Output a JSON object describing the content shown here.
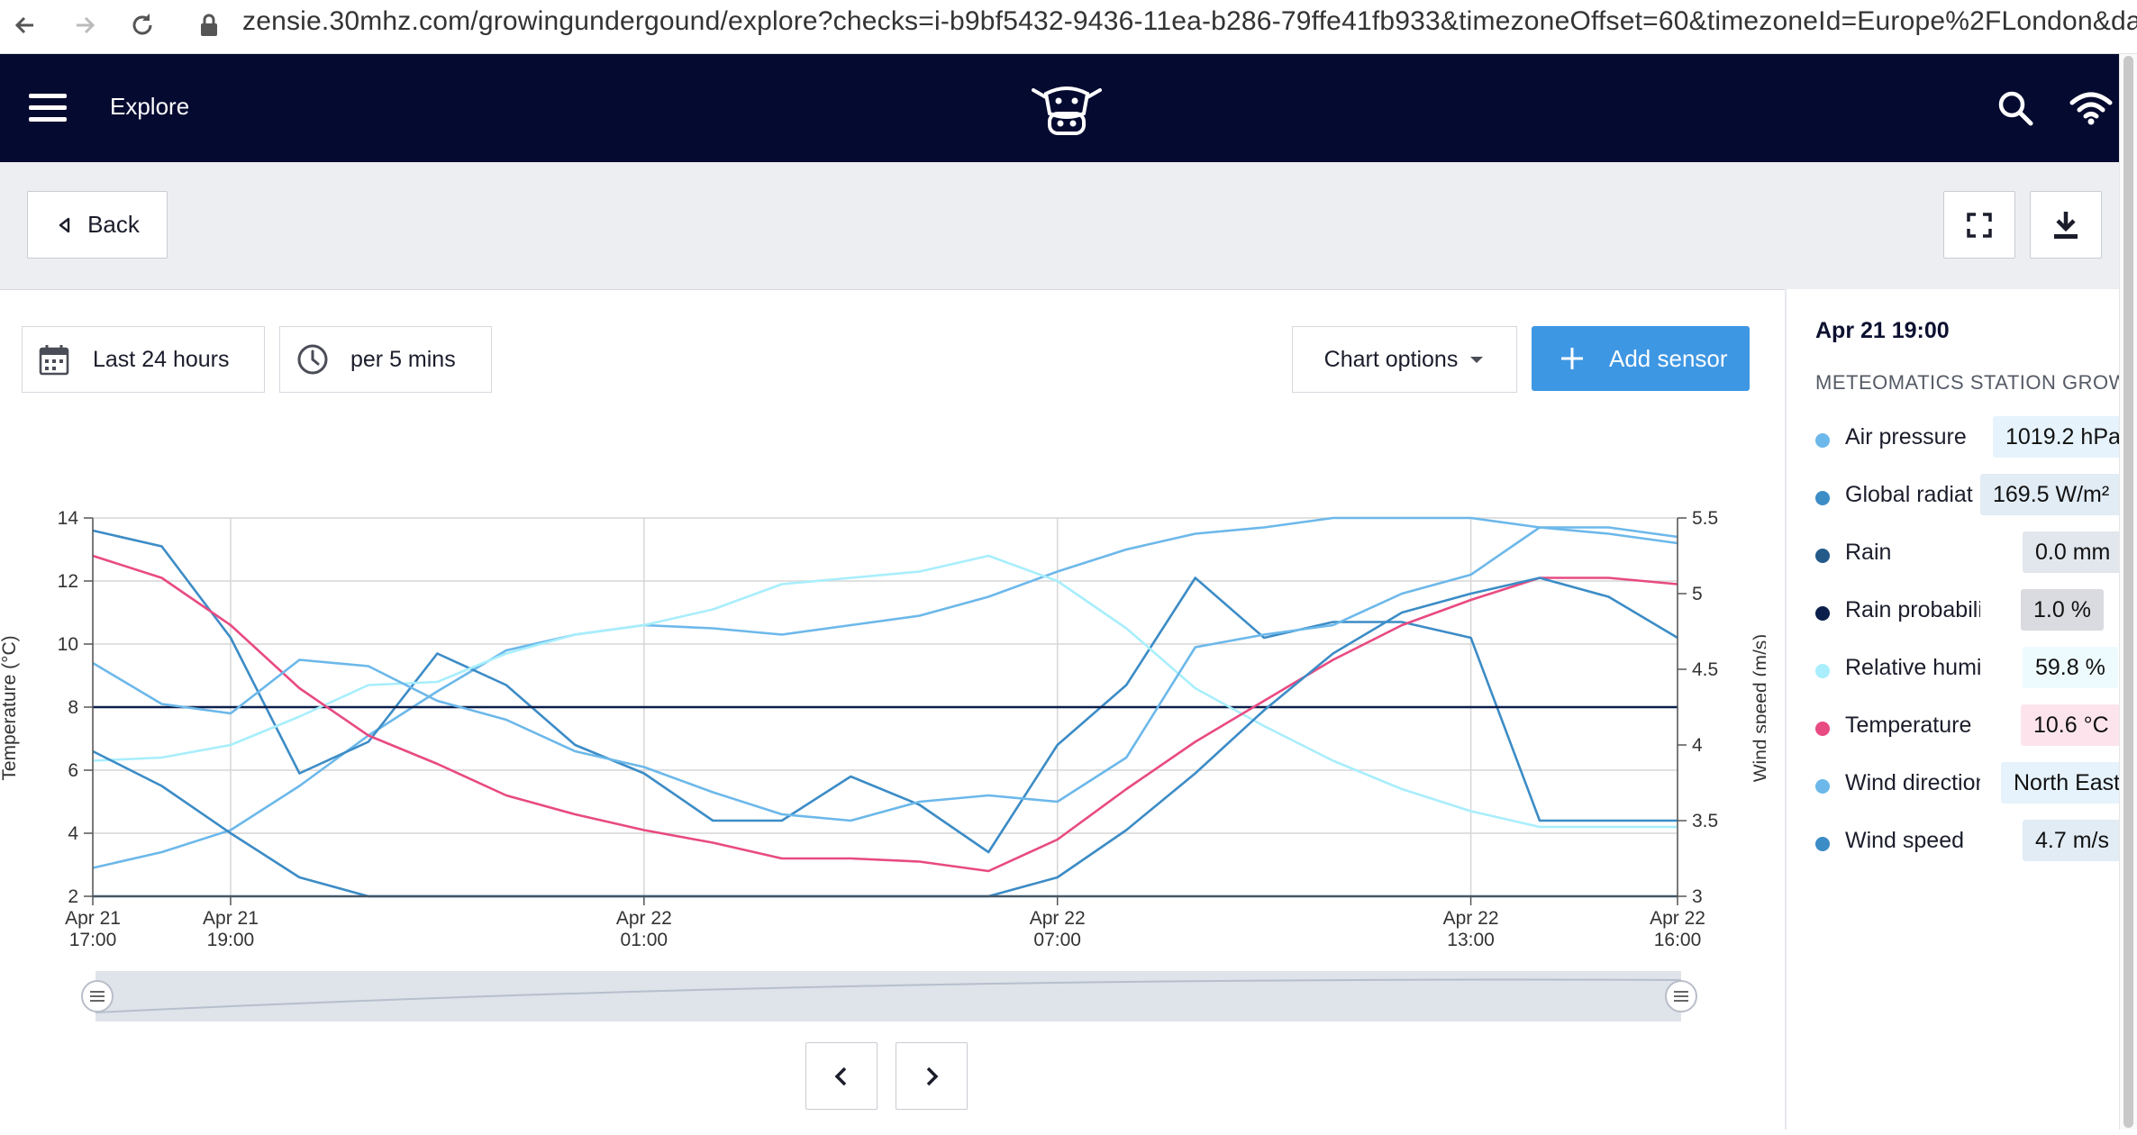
{
  "browser": {
    "url": "zensie.30mhz.com/growingundergound/explore?checks=i-b9bf5432-9436-11ea-b286-79ffe41fb933&timezoneOffset=60&timezoneId=Europe%2FLondon&da"
  },
  "header": {
    "title": "Explore"
  },
  "toolbar": {
    "back_label": "Back"
  },
  "controls": {
    "range_label": "Last 24 hours",
    "interval_label": "per 5 mins",
    "chart_options_label": "Chart options",
    "add_sensor_label": "Add sensor"
  },
  "side": {
    "timestamp": "Apr 21 19:00",
    "station": "METEOMATICS STATION GROW…",
    "items": [
      {
        "label": "Air pressure",
        "value": "1019.2 hPa",
        "color": "#6cb8ea",
        "bg": "#e6f3fc"
      },
      {
        "label": "Global radiat",
        "value": "169.5 W/m²",
        "color": "#3c8cc6",
        "bg": "#e1ecf5"
      },
      {
        "label": "Rain",
        "value": "0.0 mm",
        "color": "#235a8a",
        "bg": "#e2e6ed"
      },
      {
        "label": "Rain probability",
        "value": "1.0 %",
        "color": "#0b1f4a",
        "bg": "#d9dbe1"
      },
      {
        "label": "Relative humidity",
        "value": "59.8 %",
        "color": "#a8eefc",
        "bg": "#eefbfe"
      },
      {
        "label": "Temperature",
        "value": "10.6 °C",
        "color": "#e84a82",
        "bg": "#fde4ec"
      },
      {
        "label": "Wind direction",
        "value": "North East",
        "color": "#6cb8ea",
        "bg": "#e6f3fc"
      },
      {
        "label": "Wind speed",
        "value": "4.7 m/s",
        "color": "#3c8cc6",
        "bg": "#e1ecf5"
      }
    ]
  },
  "chart_data": {
    "type": "line",
    "x_ticks": [
      {
        "line1": "Apr 21",
        "line2": "17:00",
        "t": 0
      },
      {
        "line1": "Apr 21",
        "line2": "19:00",
        "t": 2
      },
      {
        "line1": "Apr 22",
        "line2": "01:00",
        "t": 8
      },
      {
        "line1": "Apr 22",
        "line2": "07:00",
        "t": 14
      },
      {
        "line1": "Apr 22",
        "line2": "13:00",
        "t": 20
      },
      {
        "line1": "Apr 22",
        "line2": "16:00",
        "t": 23
      }
    ],
    "x_domain": [
      0,
      23
    ],
    "ylabel_left": "Temperature (°C)",
    "ylabel_right": "Wind speed (m/s)",
    "y_left": {
      "min": 2,
      "max": 14,
      "ticks": [
        2,
        4,
        6,
        8,
        10,
        12,
        14
      ]
    },
    "y_right": {
      "min": 3,
      "max": 5.5,
      "ticks": [
        "3",
        "3.5",
        "4",
        "4.5",
        "5",
        "5.5"
      ],
      "values": [
        3,
        3.5,
        4,
        4.5,
        5,
        5.5
      ]
    },
    "series": [
      {
        "name": "Air pressure",
        "color": "#6cb8ea",
        "x": [
          0,
          1,
          2,
          3,
          4,
          5,
          6,
          7,
          8,
          9,
          10,
          11,
          12,
          13,
          14,
          15,
          16,
          17,
          18,
          19,
          20,
          21,
          22,
          23
        ],
        "y": [
          2.9,
          3.4,
          4.1,
          5.5,
          7.1,
          8.5,
          9.8,
          10.3,
          10.6,
          10.5,
          10.3,
          10.6,
          10.9,
          11.5,
          12.3,
          13.0,
          13.5,
          13.7,
          14.0,
          14.0,
          14.0,
          13.7,
          13.5,
          13.2
        ]
      },
      {
        "name": "Global radiation",
        "color": "#3c8cc6",
        "x": [
          0,
          1,
          2,
          3,
          4,
          5,
          6,
          7,
          8,
          9,
          10,
          11,
          12,
          13,
          14,
          15,
          16,
          17,
          18,
          19,
          20,
          21,
          22,
          23
        ],
        "y": [
          13.6,
          13.1,
          10.2,
          5.9,
          6.9,
          9.7,
          8.7,
          6.8,
          5.9,
          4.4,
          4.4,
          5.8,
          4.9,
          3.4,
          6.8,
          8.7,
          12.1,
          10.2,
          10.7,
          10.7,
          10.2,
          4.4,
          4.4,
          4.4
        ]
      },
      {
        "name": "Rain probability",
        "color": "#0b1f4a",
        "x": [
          0,
          23
        ],
        "y": [
          8.0,
          8.0
        ]
      },
      {
        "name": "Relative humidity",
        "color": "#a8eefc",
        "x": [
          0,
          1,
          2,
          3,
          4,
          5,
          6,
          7,
          8,
          9,
          10,
          11,
          12,
          13,
          14,
          15,
          16,
          17,
          18,
          19,
          20,
          21,
          22,
          23
        ],
        "y": [
          6.3,
          6.4,
          6.8,
          7.7,
          8.7,
          8.8,
          9.7,
          10.3,
          10.6,
          11.1,
          11.9,
          12.1,
          12.3,
          12.8,
          12.0,
          10.5,
          8.6,
          7.4,
          6.3,
          5.4,
          4.7,
          4.2,
          4.2,
          4.2
        ]
      },
      {
        "name": "Temperature",
        "color": "#e84a82",
        "x": [
          0,
          1,
          2,
          3,
          4,
          5,
          6,
          7,
          8,
          9,
          10,
          11,
          12,
          13,
          14,
          15,
          16,
          17,
          18,
          19,
          20,
          21,
          22,
          23
        ],
        "y": [
          12.8,
          12.1,
          10.6,
          8.6,
          7.1,
          6.2,
          5.2,
          4.6,
          4.1,
          3.7,
          3.2,
          3.2,
          3.1,
          2.8,
          3.8,
          5.4,
          6.9,
          8.2,
          9.5,
          10.6,
          11.4,
          12.1,
          12.1,
          11.9
        ]
      },
      {
        "name": "Wind direction",
        "color": "#6cb8ea",
        "x": [
          0,
          1,
          2,
          3,
          4,
          5,
          6,
          7,
          8,
          9,
          10,
          11,
          12,
          13,
          14,
          15,
          16,
          17,
          18,
          19,
          20,
          21,
          22,
          23
        ],
        "y": [
          9.4,
          8.1,
          7.8,
          9.5,
          9.3,
          8.2,
          7.6,
          6.6,
          6.1,
          5.3,
          4.6,
          4.4,
          5.0,
          5.2,
          5.0,
          6.4,
          9.9,
          10.3,
          10.6,
          11.6,
          12.2,
          13.7,
          13.7,
          13.4
        ]
      },
      {
        "name": "Wind speed",
        "color": "#3c8cc6",
        "x": [
          0,
          1,
          2,
          3,
          4,
          5,
          6,
          7,
          8,
          9,
          10,
          11,
          12,
          13,
          14,
          15,
          16,
          17,
          18,
          19,
          20,
          21,
          22,
          23
        ],
        "y": [
          6.6,
          5.5,
          4.0,
          2.6,
          2.0,
          2.0,
          2.0,
          2.0,
          2.0,
          2.0,
          2.0,
          2.0,
          2.0,
          2.0,
          2.6,
          4.1,
          5.9,
          7.9,
          9.7,
          11.0,
          11.6,
          12.1,
          11.5,
          10.2
        ]
      },
      {
        "name": "Rain",
        "color": "#235a8a",
        "x": [
          0,
          23
        ],
        "y": [
          2.0,
          2.0
        ]
      }
    ]
  }
}
